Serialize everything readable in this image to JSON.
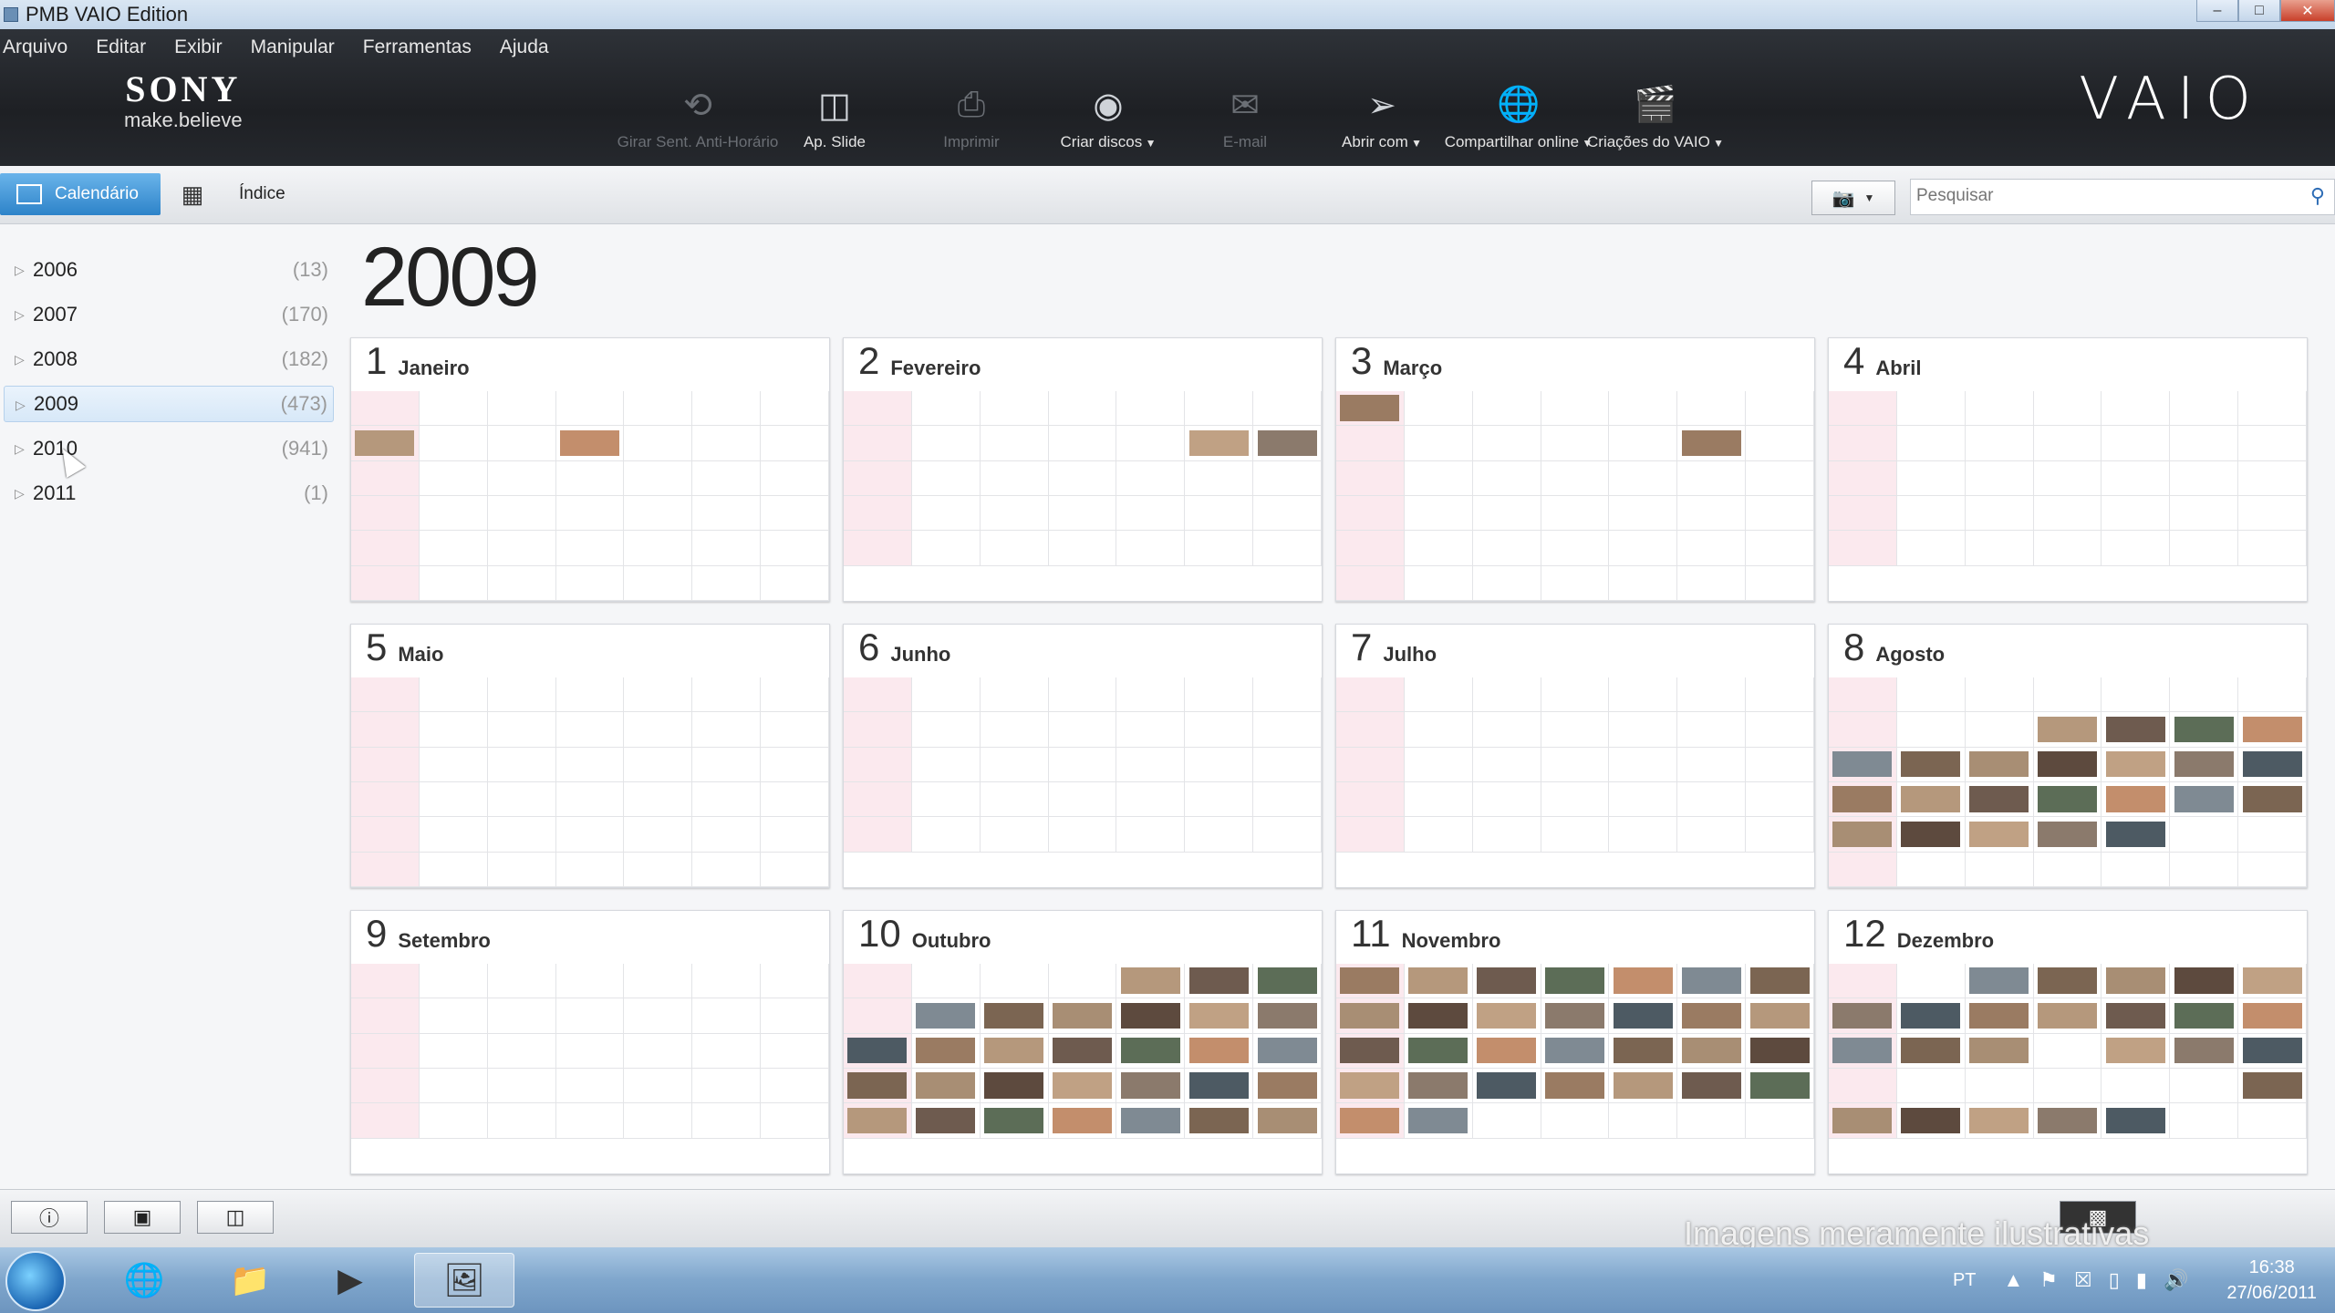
{
  "window": {
    "title": "PMB VAIO Edition"
  },
  "menu": [
    "Arquivo",
    "Editar",
    "Exibir",
    "Manipular",
    "Ferramentas",
    "Ajuda"
  ],
  "brand": {
    "name": "SONY",
    "tagline": "make.believe",
    "product": "VAIO"
  },
  "toolbar": [
    {
      "label": "Girar Sent. Anti-Horário",
      "icon": "rotate-icon",
      "enabled": false
    },
    {
      "label": "Ap. Slide",
      "icon": "slideshow-icon",
      "enabled": true
    },
    {
      "label": "Imprimir",
      "icon": "print-icon",
      "enabled": false
    },
    {
      "label": "Criar discos",
      "icon": "disc-icon",
      "enabled": true,
      "dropdown": true
    },
    {
      "label": "E-mail",
      "icon": "email-icon",
      "enabled": false
    },
    {
      "label": "Abrir com",
      "icon": "open-with-icon",
      "enabled": true,
      "dropdown": true
    },
    {
      "label": "Compartilhar online",
      "icon": "globe-icon",
      "enabled": true,
      "dropdown": true
    },
    {
      "label": "Criações do VAIO",
      "icon": "clapper-icon",
      "enabled": true,
      "dropdown": true
    }
  ],
  "views": {
    "calendar": "Calendário",
    "index": "Índice"
  },
  "search": {
    "placeholder": "Pesquisar"
  },
  "years": [
    {
      "year": "2006",
      "count": "(13)"
    },
    {
      "year": "2007",
      "count": "(170)"
    },
    {
      "year": "2008",
      "count": "(182)"
    },
    {
      "year": "2009",
      "count": "(473)",
      "selected": true
    },
    {
      "year": "2010",
      "count": "(941)"
    },
    {
      "year": "2011",
      "count": "(1)"
    }
  ],
  "selected_year": "2009",
  "months": [
    {
      "num": "1",
      "name": "Janeiro",
      "blank_start": 0,
      "days": 42,
      "photos": [
        7,
        10
      ]
    },
    {
      "num": "2",
      "name": "Fevereiro",
      "blank_start": 0,
      "days": 35,
      "photos": [
        12,
        13
      ]
    },
    {
      "num": "3",
      "name": "Março",
      "blank_start": 0,
      "days": 42,
      "photos": [
        0,
        12
      ]
    },
    {
      "num": "4",
      "name": "Abril",
      "blank_start": 0,
      "days": 35,
      "photos": []
    },
    {
      "num": "5",
      "name": "Maio",
      "blank_start": 0,
      "days": 42,
      "photos": []
    },
    {
      "num": "6",
      "name": "Junho",
      "blank_start": 0,
      "days": 35,
      "photos": []
    },
    {
      "num": "7",
      "name": "Julho",
      "blank_start": 0,
      "days": 35,
      "photos": []
    },
    {
      "num": "8",
      "name": "Agosto",
      "blank_start": 0,
      "days": 42,
      "photos": [
        10,
        11,
        12,
        13,
        14,
        15,
        16,
        17,
        18,
        19,
        20,
        21,
        22,
        23,
        24,
        25,
        26,
        27,
        28,
        29,
        30,
        31,
        32
      ]
    },
    {
      "num": "9",
      "name": "Setembro",
      "blank_start": 0,
      "days": 35,
      "photos": []
    },
    {
      "num": "10",
      "name": "Outubro",
      "blank_start": 0,
      "days": 35,
      "photos": [
        4,
        5,
        6,
        8,
        9,
        10,
        11,
        12,
        13,
        14,
        15,
        16,
        17,
        18,
        19,
        20,
        21,
        22,
        23,
        24,
        25,
        26,
        27,
        28,
        29,
        30,
        31,
        32,
        33,
        34
      ]
    },
    {
      "num": "11",
      "name": "Novembro",
      "blank_start": 0,
      "days": 35,
      "photos": [
        0,
        1,
        2,
        3,
        4,
        5,
        6,
        7,
        8,
        9,
        10,
        11,
        12,
        13,
        14,
        15,
        16,
        17,
        18,
        19,
        20,
        21,
        22,
        23,
        24,
        25,
        26,
        27,
        28,
        29
      ]
    },
    {
      "num": "12",
      "name": "Dezembro",
      "blank_start": 0,
      "days": 35,
      "photos": [
        2,
        3,
        4,
        5,
        6,
        7,
        8,
        9,
        10,
        11,
        12,
        13,
        14,
        15,
        16,
        18,
        19,
        20,
        27,
        28,
        29,
        30,
        31,
        32
      ]
    }
  ],
  "bottom": {
    "watermark": "Imagens meramente ilustrativas"
  },
  "taskbar": {
    "language": "PT",
    "time": "16:38",
    "date": "27/06/2011"
  }
}
